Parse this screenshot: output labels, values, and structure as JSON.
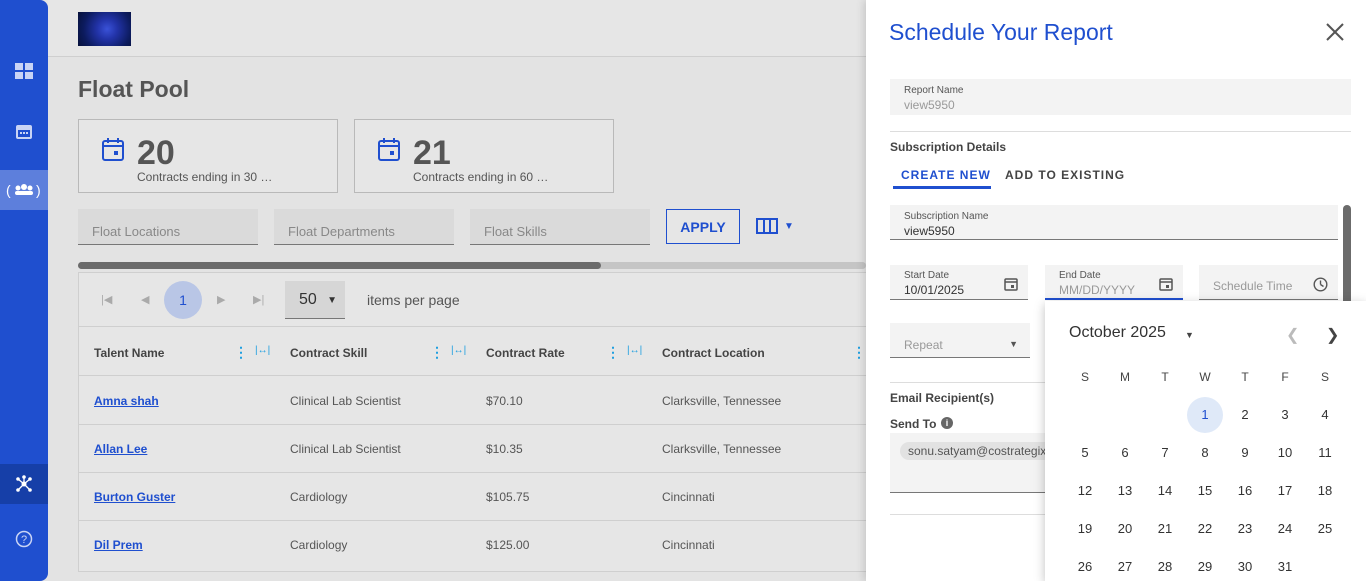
{
  "nav": {
    "items": [
      "dashboard-icon",
      "calendar-icon",
      "team-icon"
    ],
    "bottom": [
      "network-icon",
      "help-icon"
    ]
  },
  "page": {
    "title": "Float Pool",
    "stats": [
      {
        "number": "20",
        "label": "Contracts ending in 30 d..."
      },
      {
        "number": "21",
        "label": "Contracts ending in 60 d..."
      }
    ],
    "filters": [
      "Float Locations",
      "Float Departments",
      "Float Skills"
    ],
    "apply_label": "APPLY"
  },
  "pager": {
    "current_page": "1",
    "page_size": "50",
    "items_per_page_label": "items per page"
  },
  "table": {
    "columns": [
      "Talent Name",
      "Contract Skill",
      "Contract Rate",
      "Contract Location"
    ],
    "rows": [
      {
        "name": "Amna shah",
        "skill": "Clinical Lab Scientist",
        "rate": "$70.10",
        "location": "Clarksville, Tennessee"
      },
      {
        "name": "Allan Lee",
        "skill": "Clinical Lab Scientist",
        "rate": "$10.35",
        "location": "Clarksville, Tennessee"
      },
      {
        "name": "Burton Guster",
        "skill": "Cardiology",
        "rate": "$105.75",
        "location": "Cincinnati"
      },
      {
        "name": "Dil Prem",
        "skill": "Cardiology",
        "rate": "$125.00",
        "location": "Cincinnati"
      }
    ]
  },
  "panel": {
    "title": "Schedule Your Report",
    "report_name_label": "Report Name",
    "report_name_value": "view5950",
    "subscription_details_label": "Subscription Details",
    "tabs": [
      "CREATE NEW",
      "ADD TO EXISTING"
    ],
    "subscription_name_label": "Subscription Name",
    "subscription_name_value": "view5950",
    "start_date_label": "Start Date",
    "start_date_value": "10/01/2025",
    "end_date_label": "End Date",
    "end_date_placeholder": "MM/DD/YYYY",
    "schedule_time_placeholder": "Schedule Time",
    "repeat_placeholder": "Repeat",
    "email_recipients_label": "Email Recipient(s)",
    "send_to_label": "Send To",
    "recipient_email": "sonu.satyam@costrategix"
  },
  "calendar": {
    "month_label": "October 2025",
    "weekdays": [
      "S",
      "M",
      "T",
      "W",
      "T",
      "F",
      "S"
    ],
    "weeks": [
      [
        "",
        "",
        "",
        "1",
        "2",
        "3",
        "4"
      ],
      [
        "5",
        "6",
        "7",
        "8",
        "9",
        "10",
        "11"
      ],
      [
        "12",
        "13",
        "14",
        "15",
        "16",
        "17",
        "18"
      ],
      [
        "19",
        "20",
        "21",
        "22",
        "23",
        "24",
        "25"
      ],
      [
        "26",
        "27",
        "28",
        "29",
        "30",
        "31",
        ""
      ]
    ],
    "selected_day": "1"
  },
  "colors": {
    "brand": "#1f4fcf",
    "accent_icon": "#1f9fe0"
  }
}
